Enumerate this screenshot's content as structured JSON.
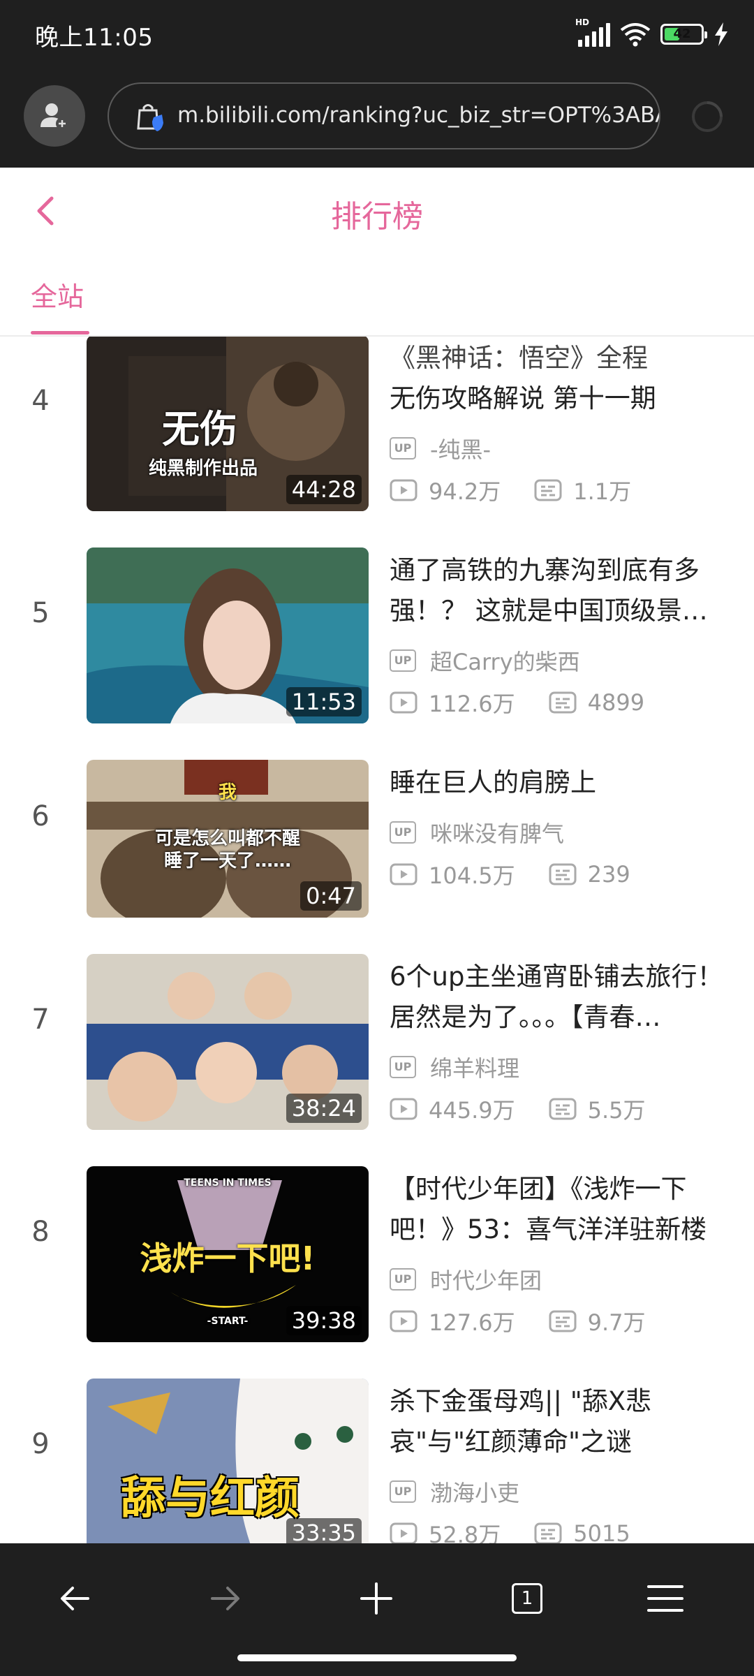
{
  "status_bar": {
    "time": "晚上11:05",
    "network": "HD",
    "battery": "42",
    "battery_level": 0.42
  },
  "browser": {
    "url": "m.bilibili.com/ranking?uc_biz_str=OPT%3ABA("
  },
  "header": {
    "title": "排行榜"
  },
  "tabs": [
    {
      "label": "全站",
      "active": true
    }
  ],
  "ranking": [
    {
      "rank": "4",
      "title": "无伤攻略解说 第十一期",
      "partial_title": "《黑神话：悟空》全程",
      "up": "-纯黑-",
      "views": "94.2万",
      "danmaku": "1.1万",
      "duration": "44:28",
      "overlay_main": "无伤",
      "overlay_sub": "纯黑制作出品"
    },
    {
      "rank": "5",
      "title": "通了高铁的九寨沟到底有多强！？ 这就是中国顶级景…",
      "up": "超Carry的柴西",
      "views": "112.6万",
      "danmaku": "4899",
      "duration": "11:53"
    },
    {
      "rank": "6",
      "title": "睡在巨人的肩膀上",
      "up": "咪咪没有脾气",
      "views": "104.5万",
      "danmaku": "239",
      "duration": "0:47",
      "overlay_top": "我",
      "overlay_line1": "可是怎么叫都不醒",
      "overlay_line2": "睡了一天了……"
    },
    {
      "rank": "7",
      "title": "6个up主坐通宵卧铺去旅行！居然是为了。。。【青春…",
      "up": "绵羊料理",
      "views": "445.9万",
      "danmaku": "5.5万",
      "duration": "38:24"
    },
    {
      "rank": "8",
      "title": "【时代少年团】《浅炸一下吧！》53：喜气洋洋驻新楼",
      "up": "时代少年团",
      "views": "127.6万",
      "danmaku": "9.7万",
      "duration": "39:38",
      "overlay_top": "TEENS IN TIMES",
      "overlay_main": "浅炸一下吧!",
      "overlay_sub": "-START-"
    },
    {
      "rank": "9",
      "title": "杀下金蛋母鸡|| \"舔X悲哀\"与\"红颜薄命\"之谜",
      "up": "渤海小吏",
      "views": "52.8万",
      "danmaku": "5015",
      "duration": "33:35",
      "overlay_main": "舔与红颜"
    }
  ],
  "labels": {
    "up_tag": "UP"
  },
  "bottom_nav": {
    "tab_count": "1",
    "icons": [
      "back-arrow-icon",
      "forward-arrow-icon",
      "plus-icon",
      "tabs-icon",
      "menu-icon"
    ]
  },
  "colors": {
    "accent": "#e5679b",
    "dark_bar": "#1f1f1f"
  }
}
